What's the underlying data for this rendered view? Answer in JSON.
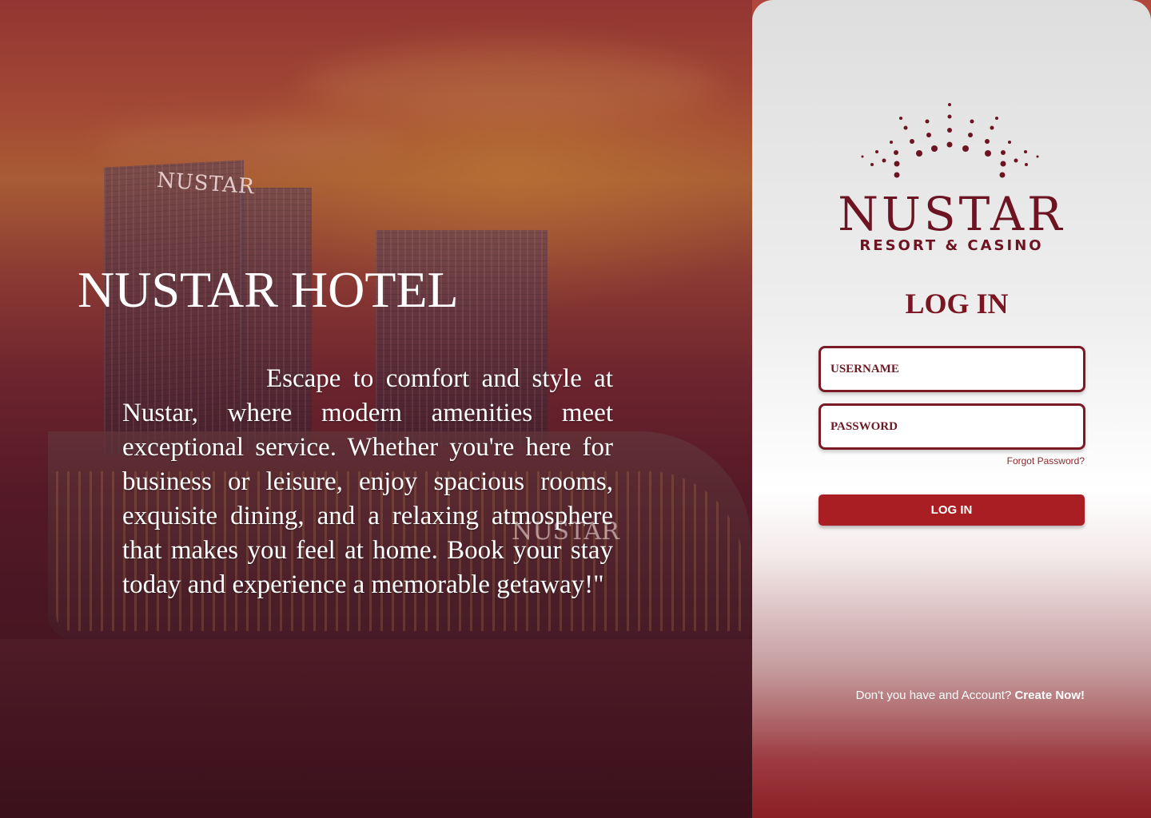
{
  "hero": {
    "title": "NUSTAR HOTEL",
    "description": "Escape to comfort and style at Nustar, where modern amenities meet exceptional service. Whether you're here for business or leisure, enjoy spacious rooms, exquisite dining, and a relaxing atmosphere that makes you feel at home. Book your stay today and experience a memorable getaway!\"",
    "building_sign": "NUSTAR",
    "resort_sign": "NUSTAR"
  },
  "brand": {
    "name": "NUSTAR",
    "tagline": "RESORT & CASINO",
    "color": "#6d1422"
  },
  "login": {
    "title": "LOG IN",
    "username_placeholder": "USERNAME",
    "username_value": "",
    "password_placeholder": "PASSWORD",
    "password_value": "",
    "forgot_label": "Forgot Password?",
    "submit_label": "LOG IN",
    "button_color": "#a81e22"
  },
  "signup": {
    "prompt": "Don't you have and Account?",
    "link_label": "Create Now!"
  }
}
